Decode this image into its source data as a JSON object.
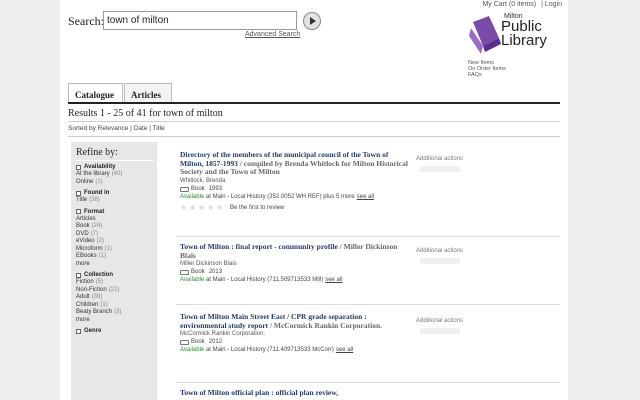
{
  "header": {
    "search_label": "Search:",
    "search_value": "town of milton",
    "advanced_search": "Advanced Search",
    "top_links": [
      "My Cart (0 items)",
      "|",
      "Login"
    ]
  },
  "logo": {
    "line1": "Milton",
    "line2": "Public",
    "line3": "Library",
    "brand_color": "#7a4aa8"
  },
  "account_links": [
    "New Items",
    "On Order Items",
    "FAQs"
  ],
  "tabs": [
    {
      "label": "Catalogue",
      "active": true
    },
    {
      "label": "Articles",
      "active": false
    }
  ],
  "results": {
    "heading": "Results 1 - 25 of 41 for town of milton",
    "sort": {
      "label": "Sorted by",
      "options": [
        "Relevance",
        "|",
        "Date",
        "|",
        "Title"
      ]
    }
  },
  "refine": {
    "title": "Refine by:",
    "groups": [
      {
        "name": "Availability",
        "items": [
          {
            "label": "At the library",
            "count": "(40)"
          },
          {
            "label": "Online",
            "count": "(1)"
          }
        ]
      },
      {
        "name": "Found in",
        "items": [
          {
            "label": "Title",
            "count": "(38)"
          }
        ]
      },
      {
        "name": "Format",
        "items": [
          {
            "label": "Articles",
            "count": ""
          },
          {
            "label": "Book",
            "count": "(24)"
          },
          {
            "label": "DVD",
            "count": "(7)"
          },
          {
            "label": "eVideo",
            "count": "(2)"
          },
          {
            "label": "Microform",
            "count": "(1)"
          },
          {
            "label": "EBooks",
            "count": "(1)"
          }
        ],
        "more": "more"
      },
      {
        "name": "Collection",
        "items": [
          {
            "label": "Fiction",
            "count": "(5)"
          },
          {
            "label": "Non-Fiction",
            "count": "(22)"
          },
          {
            "label": "Adult",
            "count": "(39)"
          },
          {
            "label": "Children",
            "count": "(1)"
          },
          {
            "label": "Beaty Branch",
            "count": "(3)"
          }
        ],
        "more": "more"
      },
      {
        "name": "Genre",
        "items": []
      }
    ]
  },
  "records": [
    {
      "title": "Directory of the members of the municipal council of the Town of Milton, 1857-1993",
      "responsibility": " / compiled by Brenda Whitlock for Milton Historical Society and the Town of Milton",
      "author": "Whitlock, Brenda",
      "format": "Book",
      "year": "1993",
      "availability_word": "Available",
      "availability_rest": " at Main - Local History (352.0052 WH REF) plus 5 more",
      "see_all": "see all",
      "review_prompt": "Be the first to review",
      "actions_label": "Additional actions"
    },
    {
      "title": "Town of Milton : final report - community profile",
      "responsibility": " / Miller Dickinson Blais",
      "author": "Miller Dickinson Blais",
      "format": "Book",
      "year": "2013",
      "availability_word": "Available",
      "availability_rest": " at Main - Local History (711.509713533 Mill)",
      "see_all": "see all",
      "review_prompt": "",
      "actions_label": "Additional actions"
    },
    {
      "title": "Town of Milton Main Street East / CPR grade separation : environmental study report",
      "responsibility": " / McCormick Rankin Corporation.",
      "author": "McCormick Rankin Corporation.",
      "format": "Book",
      "year": "2012",
      "availability_word": "Available",
      "availability_rest": " at Main - Local History (711.409713533 McCorr)",
      "see_all": "see all",
      "review_prompt": "",
      "actions_label": "Additional actions"
    },
    {
      "title": "Town of Milton official plan : official plan review,",
      "responsibility": "",
      "author": "",
      "format": "",
      "year": "",
      "availability_word": "",
      "availability_rest": "",
      "see_all": "",
      "review_prompt": "",
      "actions_label": ""
    }
  ]
}
